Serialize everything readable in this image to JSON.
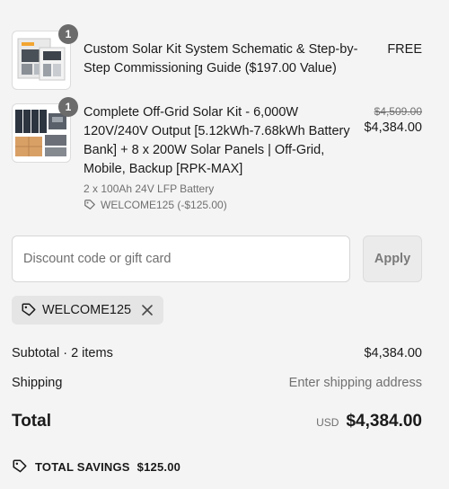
{
  "items": [
    {
      "quantity": "1",
      "title": "Custom Solar Kit System Schematic & Step-by-Step Commissioning Guide ($197.00 Value)",
      "price": "FREE",
      "thumbnail_icon": "guide-booklet-thumbnail"
    },
    {
      "quantity": "1",
      "title": "Complete Off-Grid Solar Kit - 6,000W 120V/240V Output [5.12kWh-7.68kWh Battery Bank] + 8 x 200W Solar Panels | Off-Grid, Mobile, Backup [RPK-MAX]",
      "original_price": "$4,509.00",
      "price": "$4,384.00",
      "variant": "2 x 100Ah 24V LFP Battery",
      "discount": "WELCOME125 (-$125.00)",
      "thumbnail_icon": "solar-kit-thumbnail"
    }
  ],
  "discount": {
    "placeholder": "Discount code or gift card",
    "value": "",
    "apply_label": "Apply",
    "applied_code": "WELCOME125"
  },
  "summary": {
    "subtotal_label": "Subtotal · 2 items",
    "subtotal_value": "$4,384.00",
    "shipping_label": "Shipping",
    "shipping_value": "Enter shipping address",
    "total_label": "Total",
    "currency": "USD",
    "total_value": "$4,384.00",
    "savings_label": "TOTAL SAVINGS",
    "savings_value": "$125.00"
  },
  "colors": {
    "background": "#f4f4f4",
    "text": "#1a1a1a",
    "muted": "#707070",
    "badge": "#6b6b6b"
  }
}
